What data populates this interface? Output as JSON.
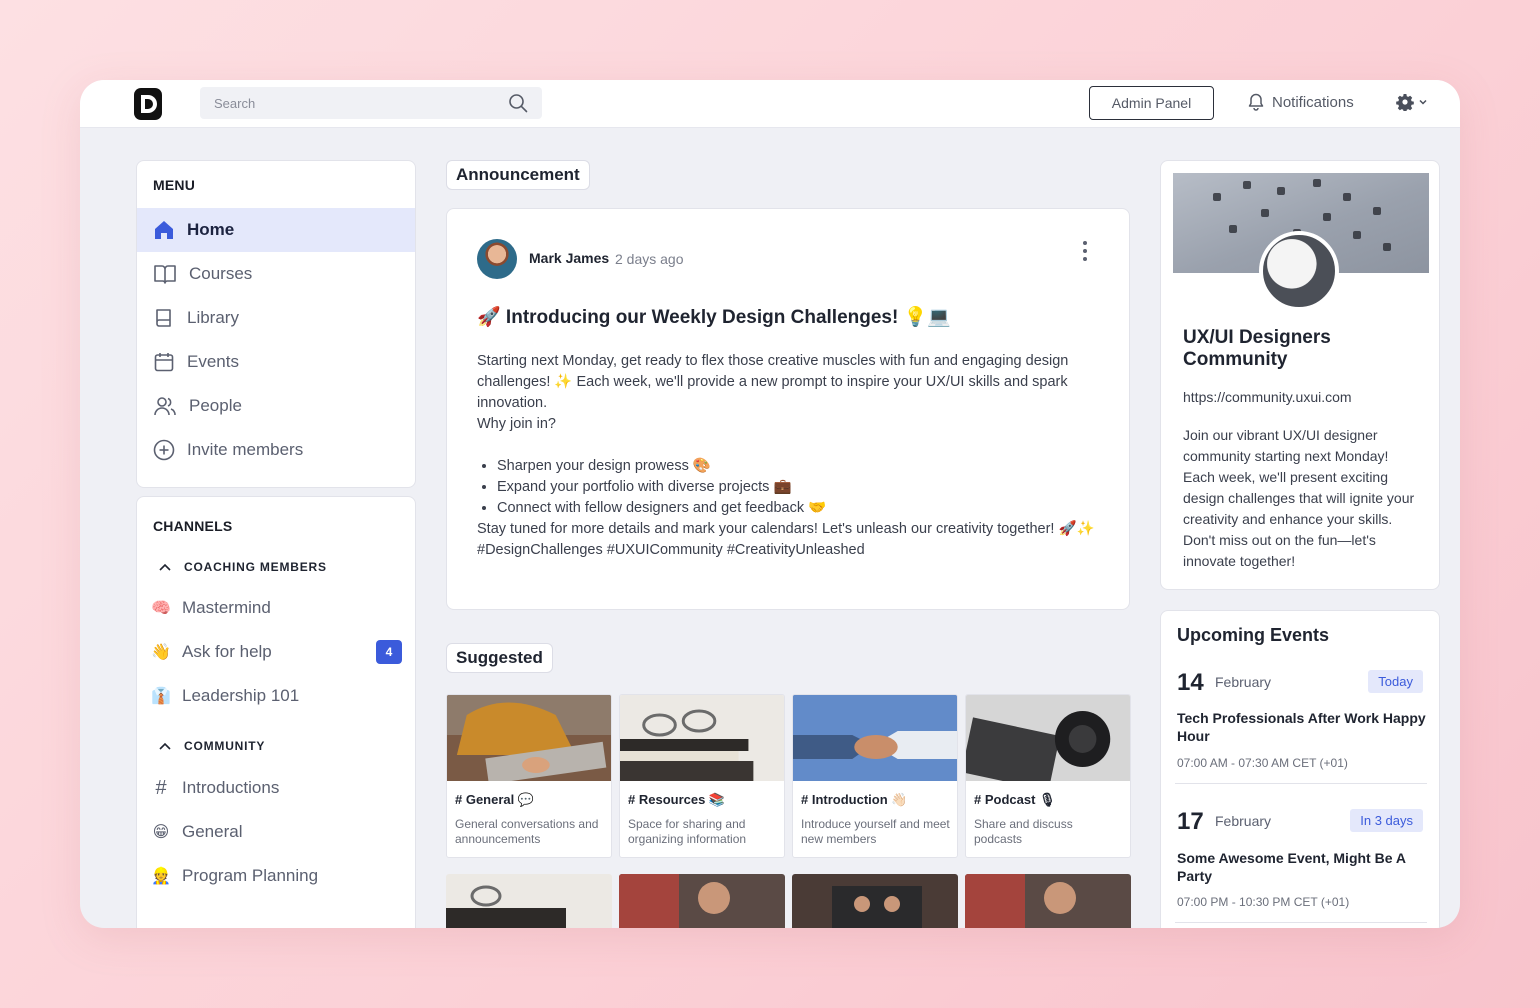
{
  "header": {
    "search_placeholder": "Search",
    "admin_label": "Admin Panel",
    "notifications_label": "Notifications"
  },
  "menu": {
    "title": "MENU",
    "items": [
      {
        "label": "Home",
        "icon": "home-icon"
      },
      {
        "label": "Courses",
        "icon": "book-open-icon"
      },
      {
        "label": "Library",
        "icon": "book-icon"
      },
      {
        "label": "Events",
        "icon": "calendar-icon"
      },
      {
        "label": "People",
        "icon": "people-icon"
      },
      {
        "label": "Invite members",
        "icon": "plus-circle-icon"
      }
    ]
  },
  "channels": {
    "title": "CHANNELS",
    "groups": [
      {
        "name": "COACHING MEMBERS",
        "items": [
          {
            "emoji": "🧠",
            "label": "Mastermind"
          },
          {
            "emoji": "👋",
            "label": "Ask for help",
            "badge": "4"
          },
          {
            "emoji": "👔",
            "label": "Leadership 101"
          }
        ]
      },
      {
        "name": "COMMUNITY",
        "items": [
          {
            "emoji": "#",
            "label": "Introductions"
          },
          {
            "emoji": "😁",
            "label": "General"
          },
          {
            "emoji": "👷",
            "label": "Program Planning"
          }
        ]
      }
    ]
  },
  "announcement": {
    "section_label": "Announcement",
    "author": "Mark James",
    "time": "2 days ago",
    "title": "🚀 Introducing our Weekly Design Challenges! 💡💻",
    "paragraph1": "Starting next Monday, get ready to flex those creative muscles with fun and engaging design challenges! ✨ Each week, we'll provide a new prompt to inspire your UX/UI skills and spark innovation.",
    "paragraph2": "Why join in?",
    "bullets": [
      "Sharpen your design prowess 🎨",
      "Expand your portfolio with diverse projects 💼",
      "Connect with fellow designers and get feedback 🤝"
    ],
    "paragraph3": "Stay tuned for more details and mark your calendars! Let's unleash our creativity together! 🚀✨",
    "hashtags": "#DesignChallenges #UXUICommunity #CreativityUnleashed"
  },
  "suggested": {
    "section_label": "Suggested",
    "cards": [
      {
        "title": "# General 💬",
        "desc": "General conversations and announcements"
      },
      {
        "title": "# Resources 📚",
        "desc": "Space for sharing and organizing information"
      },
      {
        "title": "# Introduction 👋🏻",
        "desc": "Introduce yourself and meet new members"
      },
      {
        "title": "# Podcast 🎙",
        "desc": "Share and discuss podcasts"
      }
    ]
  },
  "community": {
    "name": "UX/UI Designers Community",
    "url": "https://community.uxui.com",
    "description": "Join our vibrant UX/UI designer community starting next Monday! Each week, we'll present exciting design challenges that will ignite your creativity and enhance your skills. Don't miss out on the fun—let's innovate together!"
  },
  "events": {
    "title": "Upcoming Events",
    "items": [
      {
        "day": "14",
        "month": "February",
        "tag": "Today",
        "name": "Tech Professionals After Work Happy Hour",
        "time": "07:00 AM - 07:30 AM CET (+01)"
      },
      {
        "day": "17",
        "month": "February",
        "tag": "In 3 days",
        "name": "Some Awesome Event, Might Be A Party",
        "time": "07:00 PM - 10:30 PM CET (+01)"
      }
    ]
  },
  "colors": {
    "accent": "#3b5bdb",
    "active_bg": "#e4e8fb",
    "page_bg": "#eff0f5"
  }
}
